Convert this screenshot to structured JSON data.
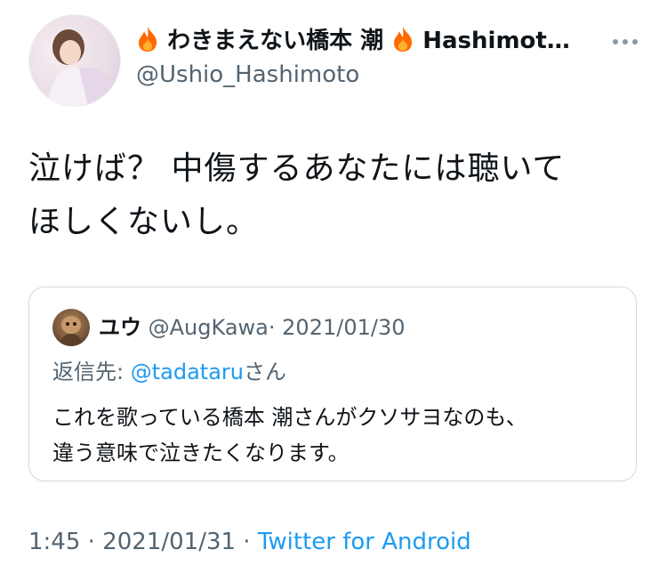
{
  "author": {
    "display_name": "わきまえない橋本 潮",
    "display_name_suffix": "Hashimot…",
    "username": "@Ushio_Hashimoto",
    "avatar_icon": "profile-photo"
  },
  "tweet": {
    "text_line1": "泣けば？ 中傷するあなたには聴いて",
    "text_line2": "ほしくないし。"
  },
  "quote": {
    "name": "ユウ",
    "handle": "@AugKawa",
    "sep": "·",
    "date": "2021/01/30",
    "reply_prefix": "返信先: ",
    "reply_mention": "@tadataru",
    "reply_suffix": "さん",
    "text_line1": "これを歌っている橋本 潮さんがクソサヨなのも、",
    "text_line2": "違う意味で泣きたくなります。"
  },
  "footer": {
    "time": "1:45",
    "sep1": " · ",
    "date": "2021/01/31",
    "sep2": " · ",
    "source": "Twitter for Android"
  },
  "colors": {
    "accent": "#1d9bf0",
    "secondary_text": "#536471",
    "flame": "#ff6a00"
  }
}
